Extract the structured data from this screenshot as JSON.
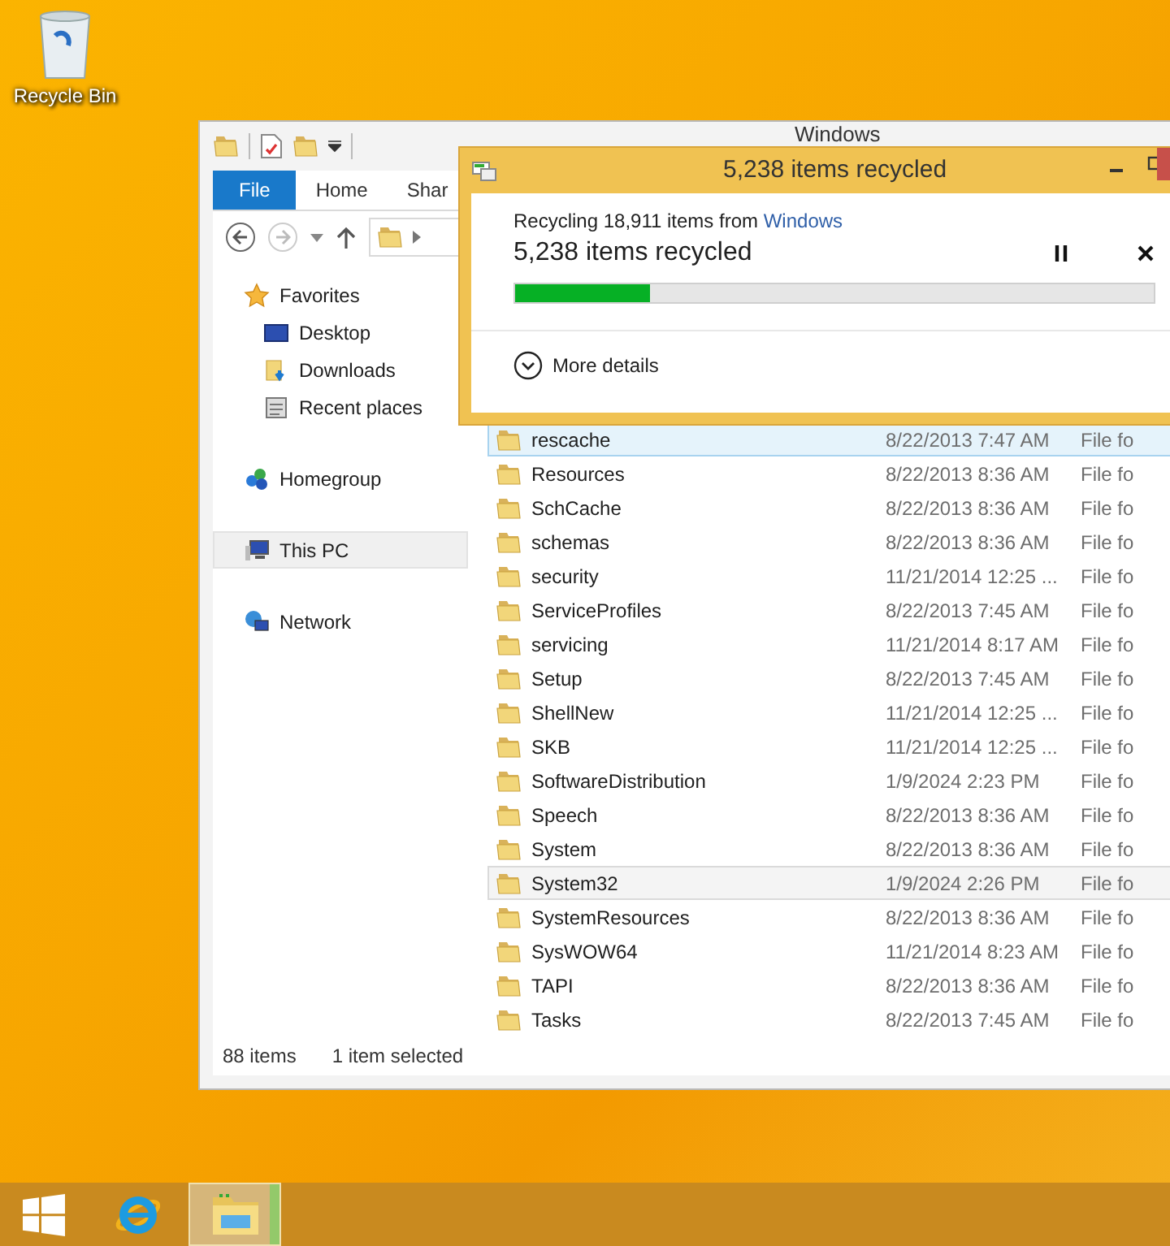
{
  "desktop_icons": [
    {
      "label": "Recycle Bin"
    }
  ],
  "explorer": {
    "title": "Windows",
    "ribbon_tabs": [
      {
        "label": "File",
        "selected": true
      },
      {
        "label": "Home",
        "selected": false
      },
      {
        "label": "Shar",
        "selected": false
      }
    ],
    "sidebar": {
      "groups": [
        {
          "label": "Favorites",
          "kind": "favorites",
          "selected": false,
          "children": [
            {
              "label": "Desktop",
              "kind": "desktop",
              "selected": false
            },
            {
              "label": "Downloads",
              "kind": "downloads",
              "selected": false
            },
            {
              "label": "Recent places",
              "kind": "recent",
              "selected": false
            }
          ]
        },
        {
          "label": "Homegroup",
          "kind": "homegroup",
          "selected": false
        },
        {
          "label": "This PC",
          "kind": "pc",
          "selected": true
        },
        {
          "label": "Network",
          "kind": "network",
          "selected": false
        }
      ]
    },
    "files": [
      {
        "name": "rescache",
        "modified": "8/22/2013 7:47 AM",
        "type": "File fo",
        "selected": false,
        "hovered": true
      },
      {
        "name": "Resources",
        "modified": "8/22/2013 8:36 AM",
        "type": "File fo",
        "selected": false,
        "hovered": false
      },
      {
        "name": "SchCache",
        "modified": "8/22/2013 8:36 AM",
        "type": "File fo",
        "selected": false,
        "hovered": false
      },
      {
        "name": "schemas",
        "modified": "8/22/2013 8:36 AM",
        "type": "File fo",
        "selected": false,
        "hovered": false
      },
      {
        "name": "security",
        "modified": "11/21/2014 12:25 ...",
        "type": "File fo",
        "selected": false,
        "hovered": false
      },
      {
        "name": "ServiceProfiles",
        "modified": "8/22/2013 7:45 AM",
        "type": "File fo",
        "selected": false,
        "hovered": false
      },
      {
        "name": "servicing",
        "modified": "11/21/2014 8:17 AM",
        "type": "File fo",
        "selected": false,
        "hovered": false
      },
      {
        "name": "Setup",
        "modified": "8/22/2013 7:45 AM",
        "type": "File fo",
        "selected": false,
        "hovered": false
      },
      {
        "name": "ShellNew",
        "modified": "11/21/2014 12:25 ...",
        "type": "File fo",
        "selected": false,
        "hovered": false
      },
      {
        "name": "SKB",
        "modified": "11/21/2014 12:25 ...",
        "type": "File fo",
        "selected": false,
        "hovered": false
      },
      {
        "name": "SoftwareDistribution",
        "modified": "1/9/2024 2:23 PM",
        "type": "File fo",
        "selected": false,
        "hovered": false
      },
      {
        "name": "Speech",
        "modified": "8/22/2013 8:36 AM",
        "type": "File fo",
        "selected": false,
        "hovered": false
      },
      {
        "name": "System",
        "modified": "8/22/2013 8:36 AM",
        "type": "File fo",
        "selected": false,
        "hovered": false
      },
      {
        "name": "System32",
        "modified": "1/9/2024 2:26 PM",
        "type": "File fo",
        "selected": true,
        "hovered": false
      },
      {
        "name": "SystemResources",
        "modified": "8/22/2013 8:36 AM",
        "type": "File fo",
        "selected": false,
        "hovered": false
      },
      {
        "name": "SysWOW64",
        "modified": "11/21/2014 8:23 AM",
        "type": "File fo",
        "selected": false,
        "hovered": false
      },
      {
        "name": "TAPI",
        "modified": "8/22/2013 8:36 AM",
        "type": "File fo",
        "selected": false,
        "hovered": false
      },
      {
        "name": "Tasks",
        "modified": "8/22/2013 7:45 AM",
        "type": "File fo",
        "selected": false,
        "hovered": false
      }
    ],
    "status_bar": {
      "item_count": "88 items",
      "selection": "1 item selected"
    }
  },
  "dialog": {
    "title": "5,238 items recycled",
    "source_prefix": "Recycling 18,911 items from",
    "source_link": "Windows",
    "heading": "5,238 items recycled",
    "level": 0.21,
    "more_details": "More details"
  },
  "taskbar": {
    "items": [
      {
        "kind": "start",
        "selected": false
      },
      {
        "kind": "browser",
        "selected": false
      },
      {
        "kind": "explorer",
        "selected": true
      }
    ]
  }
}
